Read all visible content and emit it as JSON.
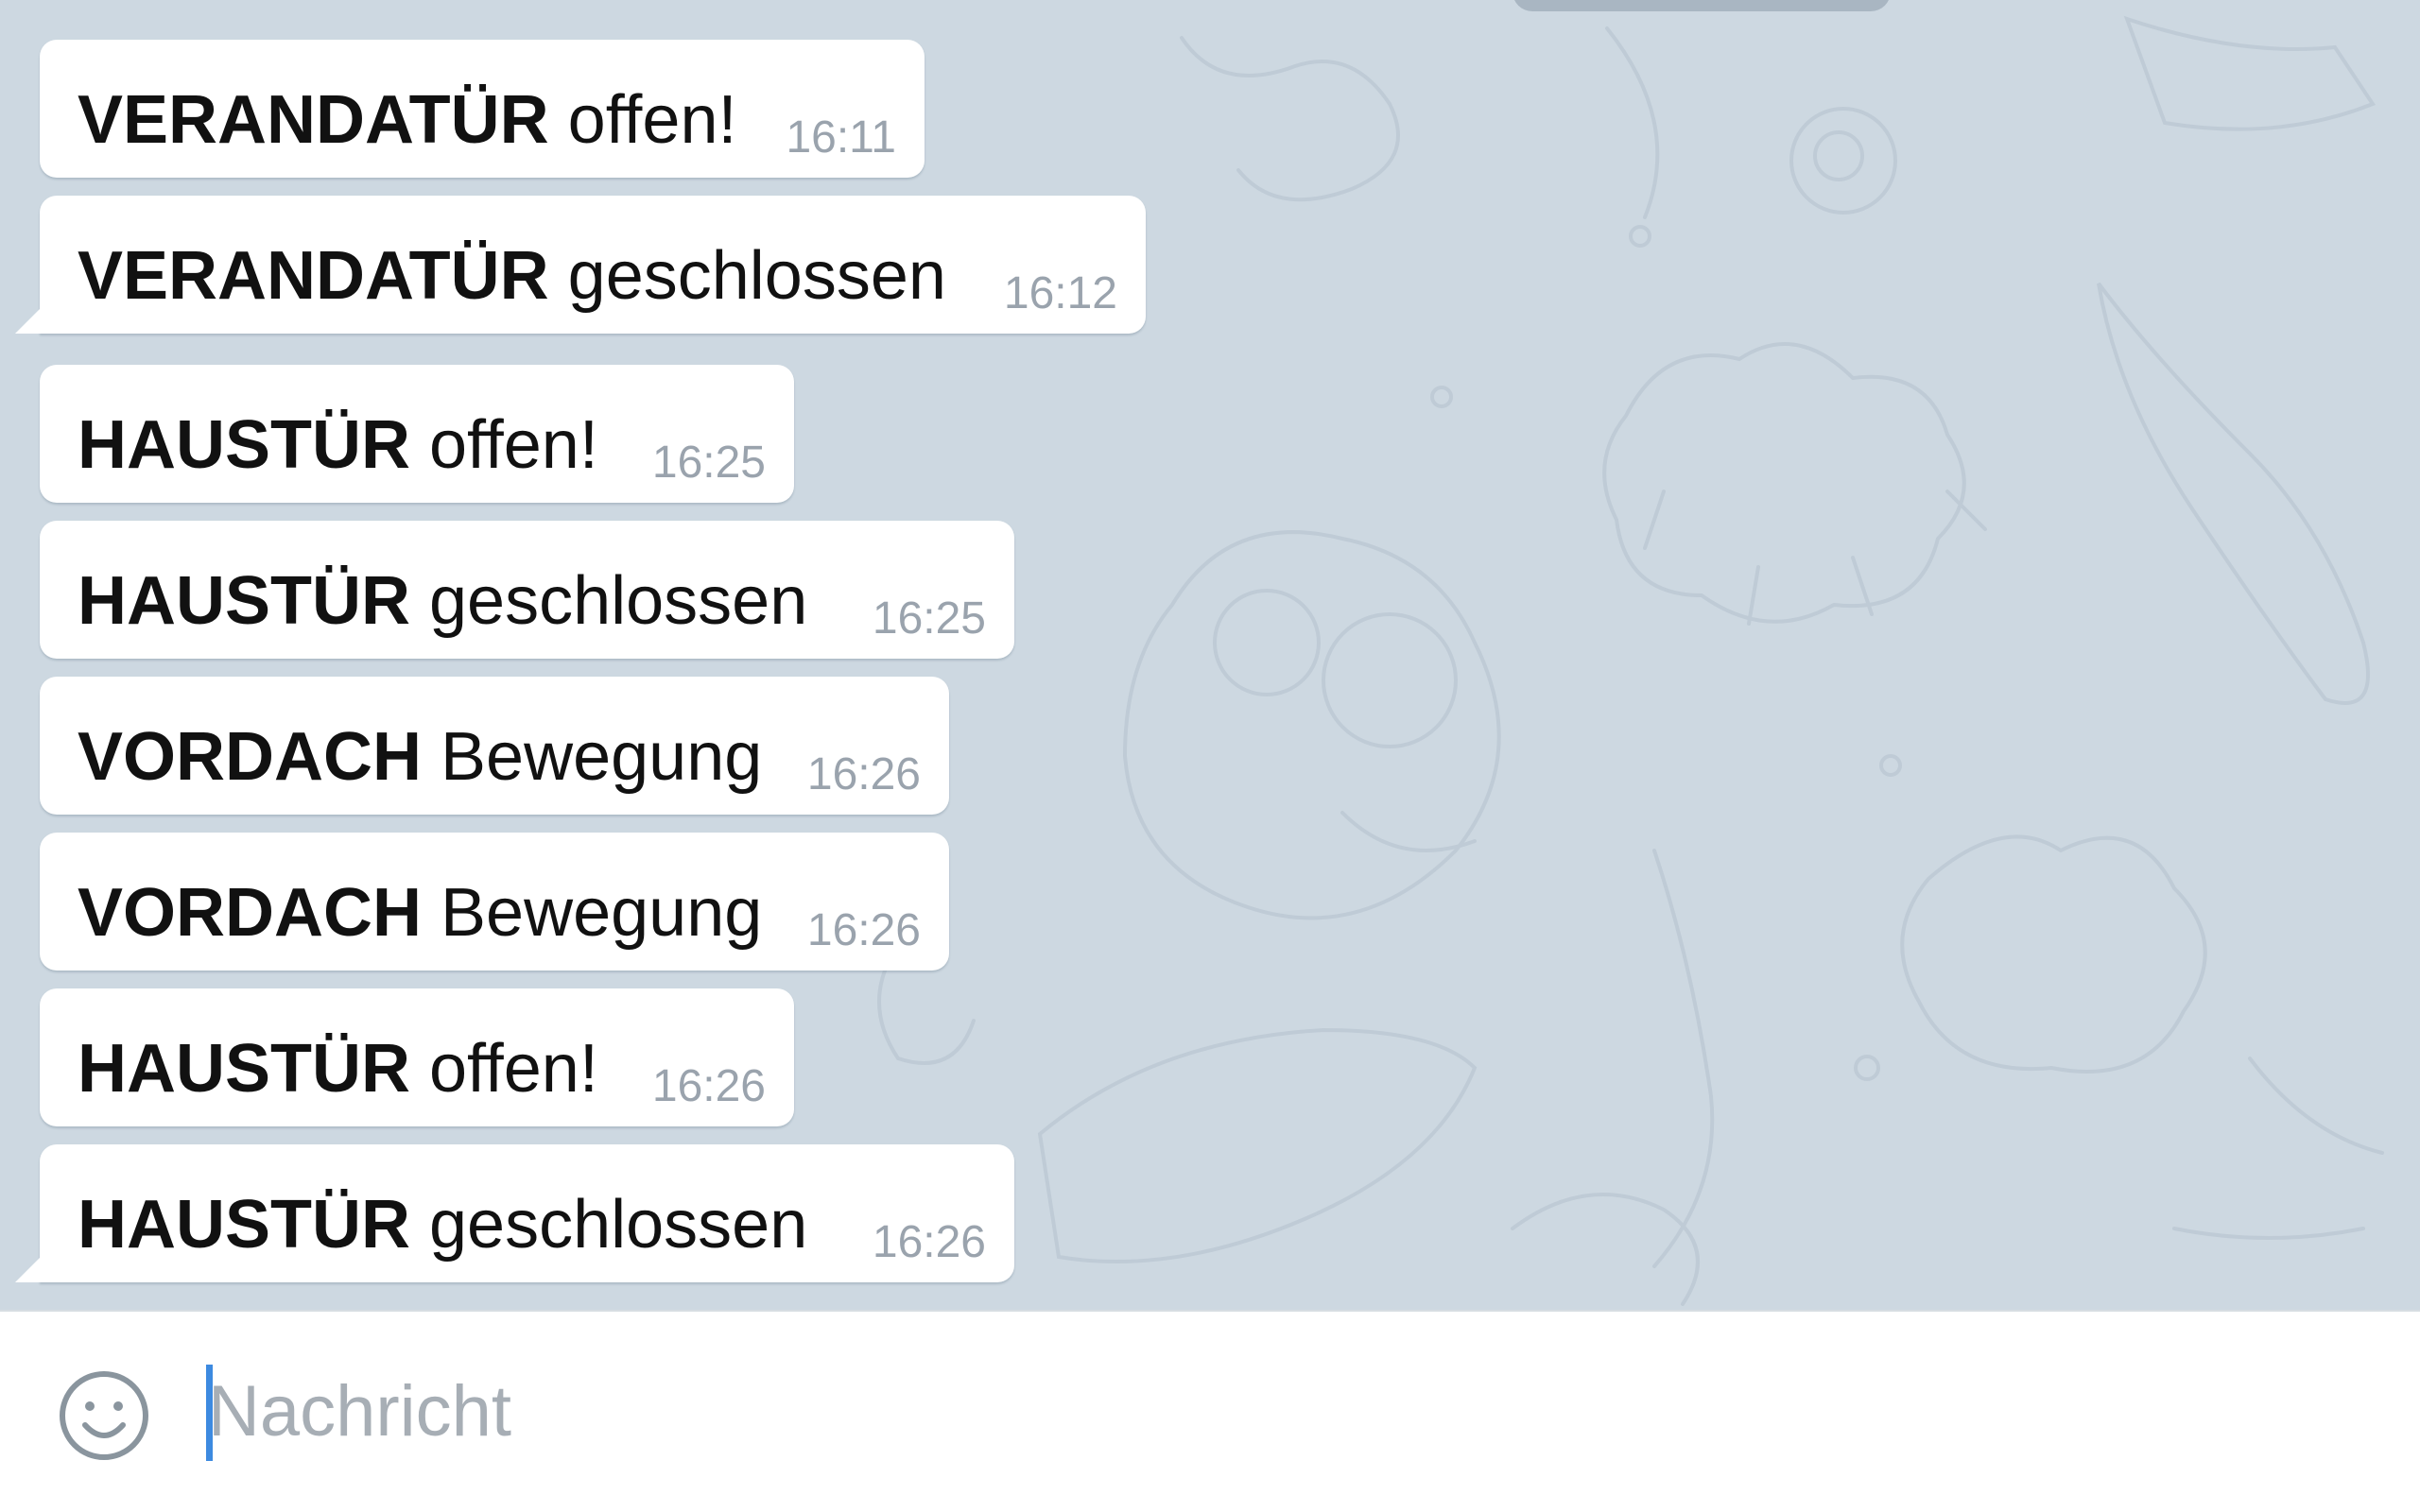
{
  "messages": [
    {
      "subject": "VERANDATÜR",
      "status": "offen!",
      "time": "16:11"
    },
    {
      "subject": "VERANDATÜR",
      "status": "geschlossen",
      "time": "16:12"
    },
    {
      "subject": "HAUSTÜR",
      "status": "offen!",
      "time": "16:25"
    },
    {
      "subject": "HAUSTÜR",
      "status": "geschlossen",
      "time": "16:25"
    },
    {
      "subject": "VORDACH",
      "status": "Bewegung",
      "time": "16:26"
    },
    {
      "subject": "VORDACH",
      "status": "Bewegung",
      "time": "16:26"
    },
    {
      "subject": "HAUSTÜR",
      "status": "offen!",
      "time": "16:26"
    },
    {
      "subject": "HAUSTÜR",
      "status": "geschlossen",
      "time": "16:26"
    }
  ],
  "composer": {
    "placeholder": "Nachricht",
    "value": "",
    "emoji_icon": "smiley-face-icon"
  },
  "colors": {
    "chat_background": "#cdd8e1",
    "bubble": "#ffffff",
    "timestamp": "#9aa3ad",
    "caret": "#3d8ae0"
  }
}
